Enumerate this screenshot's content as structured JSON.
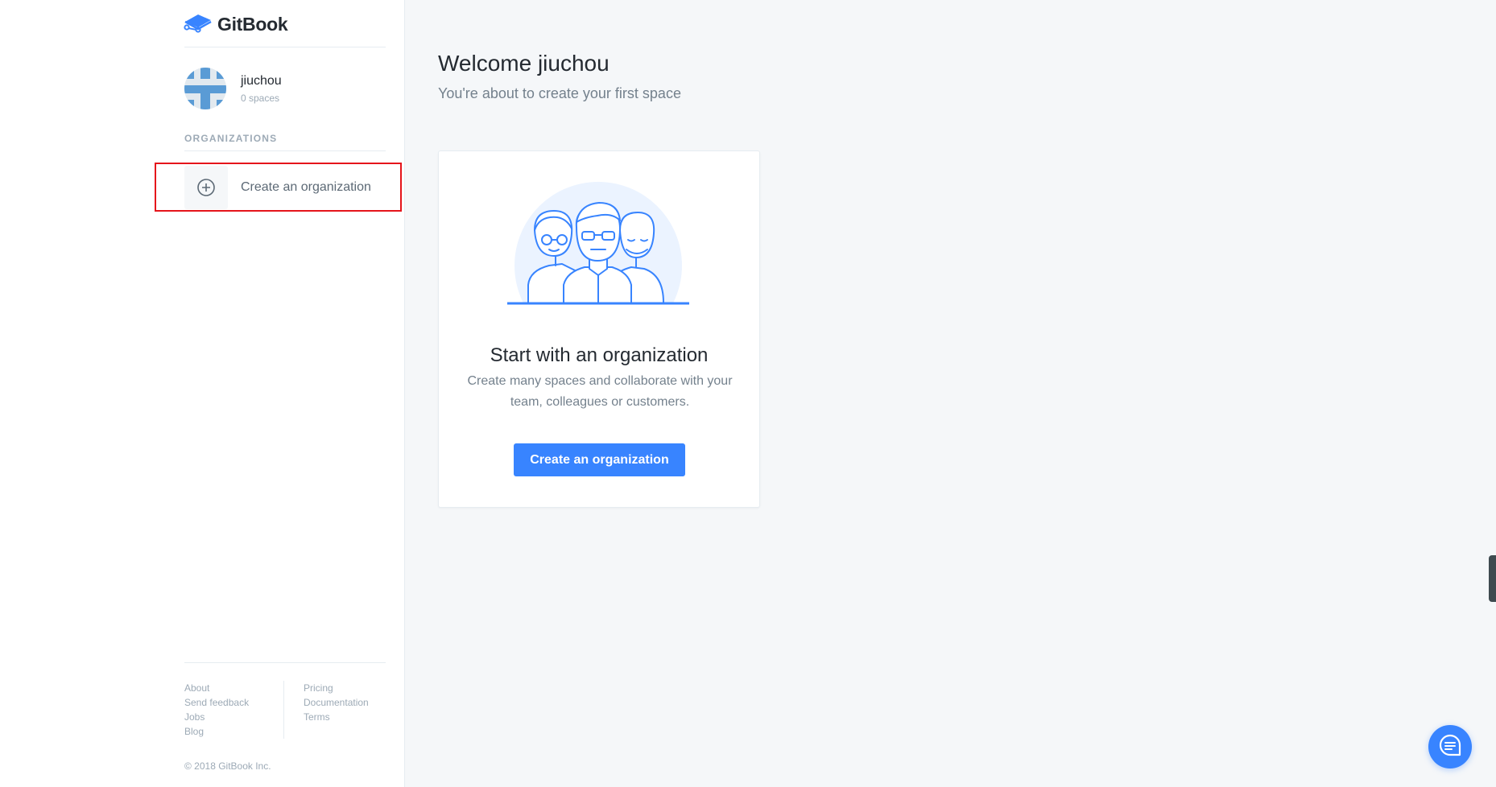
{
  "brand": {
    "name": "GitBook",
    "color": "#3884ff"
  },
  "user": {
    "name": "jiuchou",
    "spaces": "0 spaces",
    "avatar_icon": "identicon-avatar"
  },
  "sidebar": {
    "section_label": "ORGANIZATIONS",
    "create_org_label": "Create an organization",
    "create_org_icon": "plus-circle-icon"
  },
  "footer": {
    "left_links": [
      "About",
      "Send feedback",
      "Jobs",
      "Blog"
    ],
    "right_links": [
      "Pricing",
      "Documentation",
      "Terms"
    ],
    "copyright": "© 2018 GitBook Inc."
  },
  "main": {
    "welcome": "Welcome jiuchou",
    "subtitle": "You're about to create your first space",
    "card": {
      "illustration_icon": "team-people-illustration",
      "title": "Start with an organization",
      "description": "Create many spaces and collaborate with your team, colleagues or customers.",
      "button_label": "Create an organization"
    }
  },
  "chat": {
    "icon": "chat-bubble-icon"
  },
  "colors": {
    "accent": "#3884ff",
    "highlight_border": "#e5141b",
    "background": "#f5f7f9"
  }
}
